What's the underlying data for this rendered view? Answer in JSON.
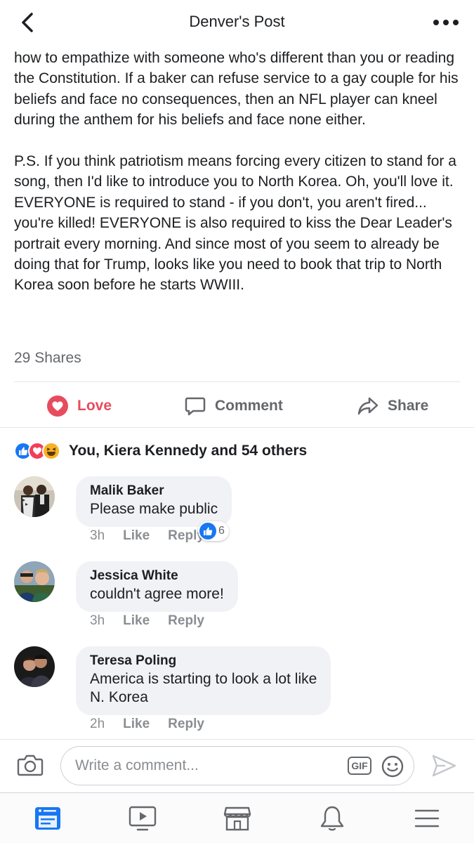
{
  "header": {
    "title": "Denver's Post",
    "back_icon": "chevron-left-icon",
    "more_icon": "more-dots-icon"
  },
  "post": {
    "paragraphs": [
      "how to empathize with someone who's different than you or reading the Constitution. If a baker can refuse service to a gay couple for his beliefs and face no consequences, then an NFL player can kneel during the anthem for his beliefs and face none either.",
      "P.S. If you think patriotism means forcing every citizen to stand for a song, then I'd like to introduce you to North Korea. Oh, you'll love it. EVERYONE is required to stand - if you don't, you aren't fired... you're killed! EVERYONE is also required to kiss the Dear Leader's portrait every morning. And since most of you seem to already be doing that for Trump, looks like you need to book that trip to North Korea soon before he starts WWIII."
    ],
    "shares": "29 Shares"
  },
  "actions": {
    "love": "Love",
    "comment": "Comment",
    "share": "Share",
    "love_color": "#e74c5e"
  },
  "reactions": {
    "summary": "You, Kiera Kennedy and 54 others",
    "icons": [
      "like-icon",
      "love-icon",
      "haha-icon"
    ]
  },
  "comments": [
    {
      "name": "Malik Baker",
      "text": "Please make public",
      "time": "3h",
      "like": "Like",
      "reply": "Reply",
      "likes": "6"
    },
    {
      "name": "Jessica White",
      "text": "couldn't agree more!",
      "time": "3h",
      "like": "Like",
      "reply": "Reply"
    },
    {
      "name": "Teresa Poling",
      "text": "America is starting to look a lot like\n N. Korea",
      "time": "2h",
      "like": "Like",
      "reply": "Reply"
    }
  ],
  "composer": {
    "placeholder": "Write a comment...",
    "gif_label": "GIF"
  },
  "tabbar": {
    "items": [
      "news-feed-icon",
      "watch-video-icon",
      "marketplace-icon",
      "notifications-bell-icon",
      "menu-icon"
    ],
    "active": "news-feed-icon",
    "accent": "#1877f2"
  }
}
